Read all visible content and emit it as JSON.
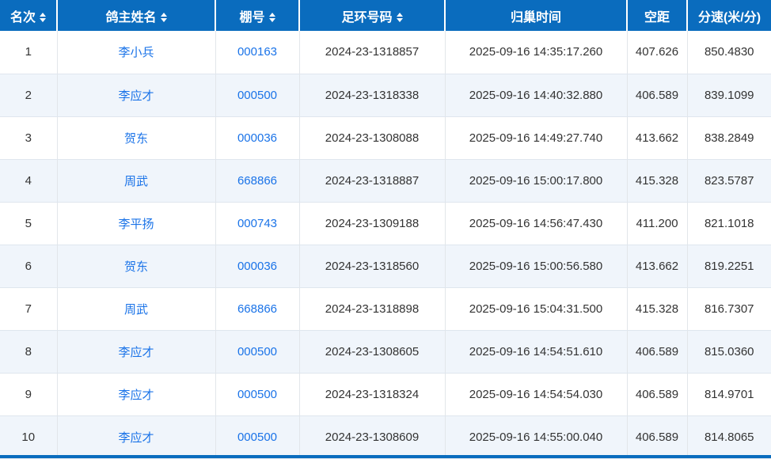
{
  "colors": {
    "header_bg": "#0a6cbe",
    "link_blue": "#1a73e8",
    "row_alt_bg": "#f0f5fb"
  },
  "table": {
    "columns": [
      {
        "key": "rank",
        "label": "名次",
        "sortable": true
      },
      {
        "key": "owner",
        "label": "鸽主姓名",
        "sortable": true
      },
      {
        "key": "loft",
        "label": "棚号",
        "sortable": true
      },
      {
        "key": "ring",
        "label": "足环号码",
        "sortable": true
      },
      {
        "key": "time",
        "label": "归巢时间",
        "sortable": false
      },
      {
        "key": "distance",
        "label": "空距",
        "sortable": false
      },
      {
        "key": "speed",
        "label": "分速(米/分)",
        "sortable": false
      }
    ],
    "rows": [
      {
        "rank": "1",
        "owner": "李小兵",
        "loft": "000163",
        "ring": "2024-23-1318857",
        "time": "2025-09-16 14:35:17.260",
        "distance": "407.626",
        "speed": "850.4830"
      },
      {
        "rank": "2",
        "owner": "李应才",
        "loft": "000500",
        "ring": "2024-23-1318338",
        "time": "2025-09-16 14:40:32.880",
        "distance": "406.589",
        "speed": "839.1099"
      },
      {
        "rank": "3",
        "owner": "贺东",
        "loft": "000036",
        "ring": "2024-23-1308088",
        "time": "2025-09-16 14:49:27.740",
        "distance": "413.662",
        "speed": "838.2849"
      },
      {
        "rank": "4",
        "owner": "周武",
        "loft": "668866",
        "ring": "2024-23-1318887",
        "time": "2025-09-16 15:00:17.800",
        "distance": "415.328",
        "speed": "823.5787"
      },
      {
        "rank": "5",
        "owner": "李平扬",
        "loft": "000743",
        "ring": "2024-23-1309188",
        "time": "2025-09-16 14:56:47.430",
        "distance": "411.200",
        "speed": "821.1018"
      },
      {
        "rank": "6",
        "owner": "贺东",
        "loft": "000036",
        "ring": "2024-23-1318560",
        "time": "2025-09-16 15:00:56.580",
        "distance": "413.662",
        "speed": "819.2251"
      },
      {
        "rank": "7",
        "owner": "周武",
        "loft": "668866",
        "ring": "2024-23-1318898",
        "time": "2025-09-16 15:04:31.500",
        "distance": "415.328",
        "speed": "816.7307"
      },
      {
        "rank": "8",
        "owner": "李应才",
        "loft": "000500",
        "ring": "2024-23-1308605",
        "time": "2025-09-16 14:54:51.610",
        "distance": "406.589",
        "speed": "815.0360"
      },
      {
        "rank": "9",
        "owner": "李应才",
        "loft": "000500",
        "ring": "2024-23-1318324",
        "time": "2025-09-16 14:54:54.030",
        "distance": "406.589",
        "speed": "814.9701"
      },
      {
        "rank": "10",
        "owner": "李应才",
        "loft": "000500",
        "ring": "2024-23-1308609",
        "time": "2025-09-16 14:55:00.040",
        "distance": "406.589",
        "speed": "814.8065"
      }
    ]
  }
}
